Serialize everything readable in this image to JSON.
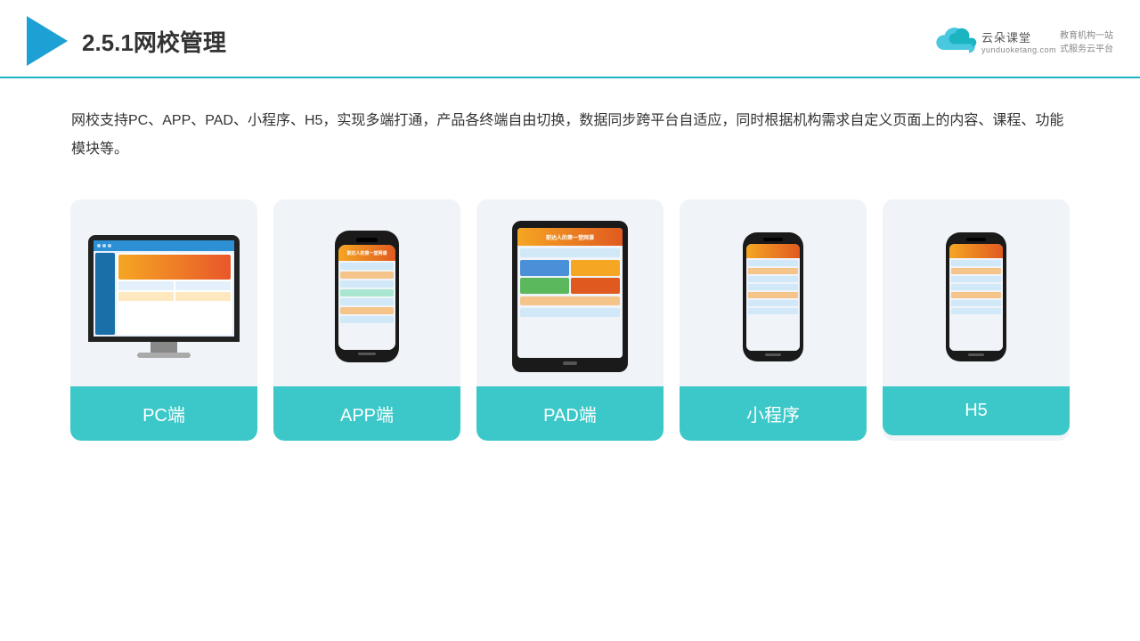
{
  "header": {
    "title": "2.5.1网校管理",
    "brand": {
      "name": "云朵课堂",
      "domain": "yunduoketang.com",
      "slogan_line1": "教育机构一站",
      "slogan_line2": "式服务云平台"
    }
  },
  "description": {
    "text": "网校支持PC、APP、PAD、小程序、H5，实现多端打通，产品各终端自由切换，数据同步跨平台自适应，同时根据机构需求自定义页面上的内容、课程、功能模块等。"
  },
  "cards": [
    {
      "id": "pc",
      "label": "PC端"
    },
    {
      "id": "app",
      "label": "APP端"
    },
    {
      "id": "pad",
      "label": "PAD端"
    },
    {
      "id": "miniprogram",
      "label": "小程序"
    },
    {
      "id": "h5",
      "label": "H5"
    }
  ]
}
